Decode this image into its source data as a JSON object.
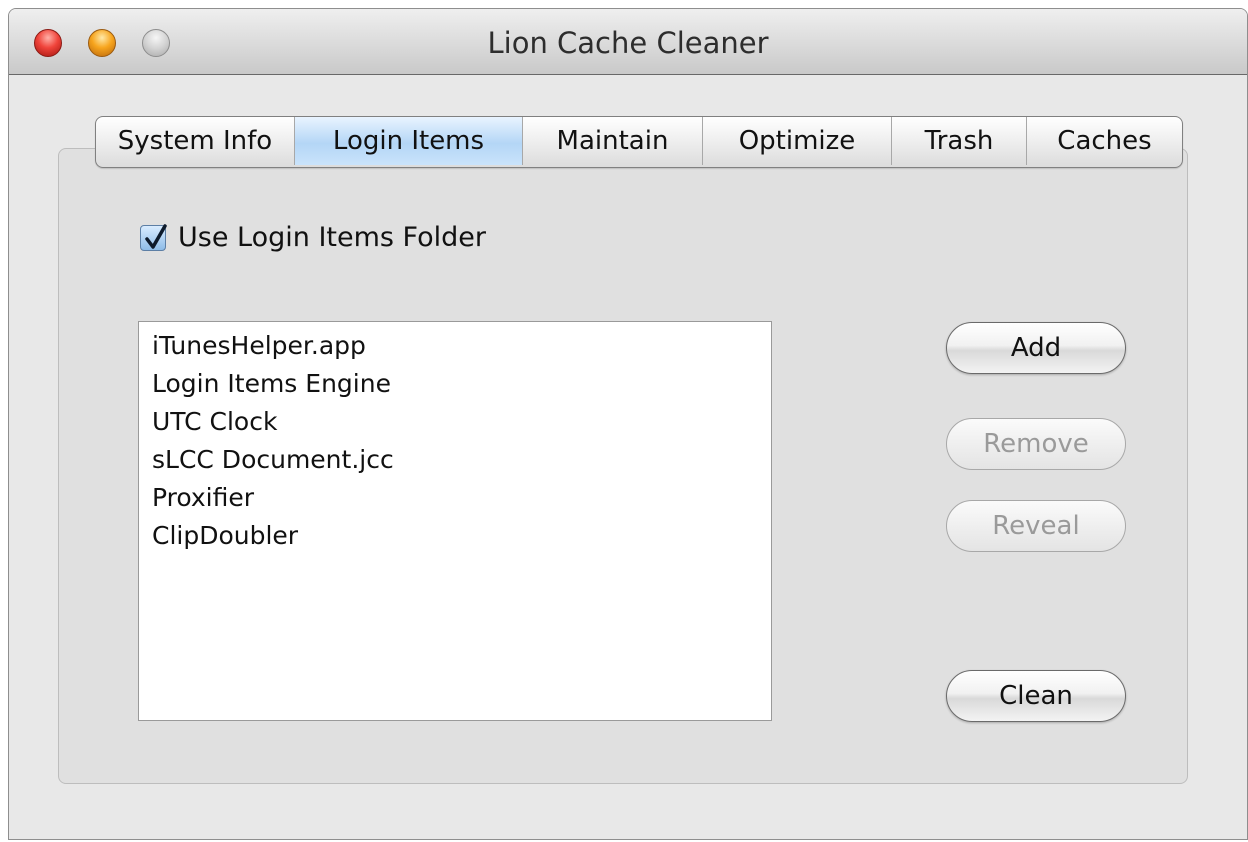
{
  "window": {
    "title": "Lion Cache Cleaner"
  },
  "tabs": [
    {
      "label": "System Info",
      "selected": false
    },
    {
      "label": "Login Items",
      "selected": true
    },
    {
      "label": "Maintain",
      "selected": false
    },
    {
      "label": "Optimize",
      "selected": false
    },
    {
      "label": "Trash",
      "selected": false
    },
    {
      "label": "Caches",
      "selected": false
    }
  ],
  "login_items": {
    "use_folder_label": "Use Login Items Folder",
    "use_folder_checked": true,
    "items": [
      "iTunesHelper.app",
      "Login Items Engine",
      "UTC Clock",
      "sLCC Document.jcc",
      "Proxifier",
      "ClipDoubler"
    ],
    "buttons": {
      "add": {
        "label": "Add",
        "enabled": true
      },
      "remove": {
        "label": "Remove",
        "enabled": false
      },
      "reveal": {
        "label": "Reveal",
        "enabled": false
      },
      "clean": {
        "label": "Clean",
        "enabled": true
      }
    }
  },
  "colors": {
    "selected_tab": "#b4d6f6",
    "close_button": "#f0443b",
    "minimize_button": "#f7a51e",
    "disabled_text": "#9a9a9a"
  }
}
